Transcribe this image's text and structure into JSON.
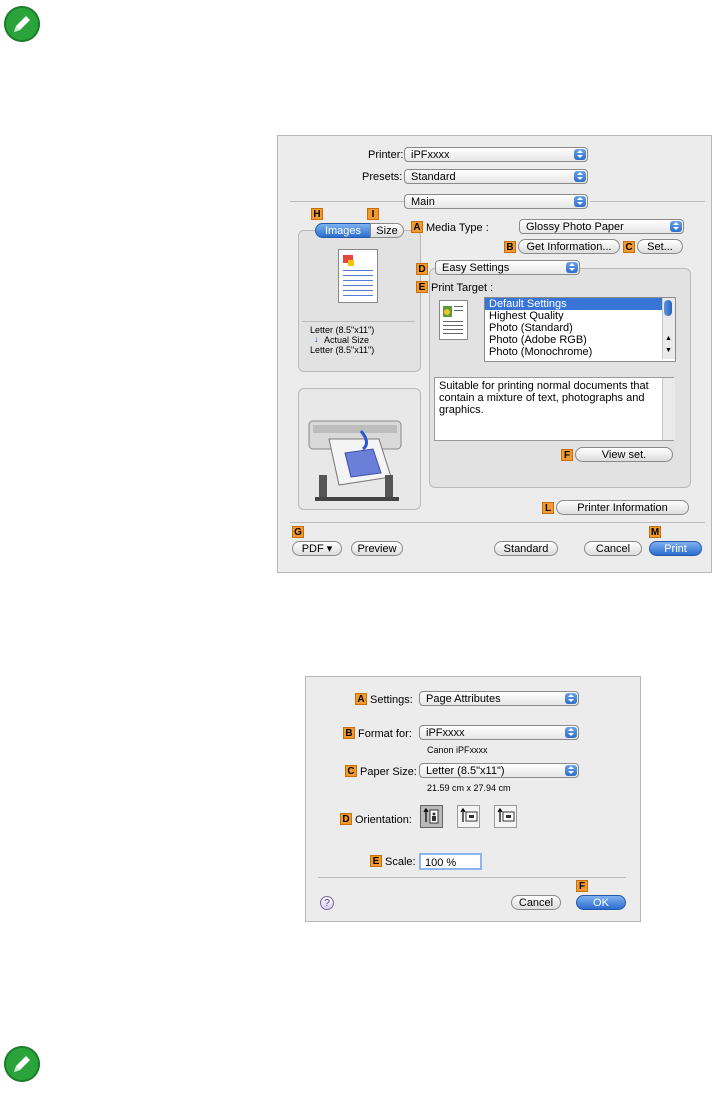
{
  "print_dialog": {
    "printer_label": "Printer:",
    "printer_value": "iPFxxxx",
    "presets_label": "Presets:",
    "presets_value": "Standard",
    "panel_value": "Main",
    "tabs": [
      {
        "tag": "H",
        "label": "Images"
      },
      {
        "tag": "I",
        "label": "Size"
      }
    ],
    "paper_info": [
      "Letter (8.5\"x11\")",
      "Actual Size",
      "Letter (8.5\"x11\")"
    ],
    "media_type": {
      "tag": "A",
      "label": "Media Type :",
      "value": "Glossy Photo Paper"
    },
    "get_information": {
      "tag": "B",
      "label": "Get Information..."
    },
    "set_button": {
      "tag": "C",
      "label": "Set..."
    },
    "mode": {
      "tag": "D",
      "value": "Easy Settings"
    },
    "print_target": {
      "tag": "E",
      "label": "Print Target :",
      "items": [
        "Default Settings",
        "Highest Quality",
        "Photo (Standard)",
        "Photo (Adobe RGB)",
        "Photo (Monochrome)"
      ],
      "selected_index": 0
    },
    "description": "Suitable for printing normal documents that contain a mixture of text, photographs and graphics.",
    "view_set": {
      "tag": "F",
      "label": "View set."
    },
    "printer_information": {
      "tag": "L",
      "label": "Printer Information"
    },
    "pdf": {
      "tag": "G",
      "label": "PDF ▾"
    },
    "preview_label": "Preview",
    "standard_label": "Standard",
    "cancel_label": "Cancel",
    "print": {
      "tag": "M",
      "label": "Print"
    }
  },
  "page_setup": {
    "settings": {
      "tag": "A",
      "label": "Settings:",
      "value": "Page Attributes"
    },
    "format_for": {
      "tag": "B",
      "label": "Format for:",
      "value": "iPFxxxx",
      "sub": "Canon iPFxxxx"
    },
    "paper_size": {
      "tag": "C",
      "label": "Paper Size:",
      "value": "Letter (8.5\"x11\")",
      "sub": "21.59 cm x 27.94 cm"
    },
    "orientation": {
      "tag": "D",
      "label": "Orientation:"
    },
    "scale": {
      "tag": "E",
      "label": "Scale:",
      "value": "100 %"
    },
    "help_label": "?",
    "cancel_label": "Cancel",
    "ok": {
      "tag": "F",
      "label": "OK"
    }
  },
  "icons": {
    "note": "note-pencil-icon"
  }
}
